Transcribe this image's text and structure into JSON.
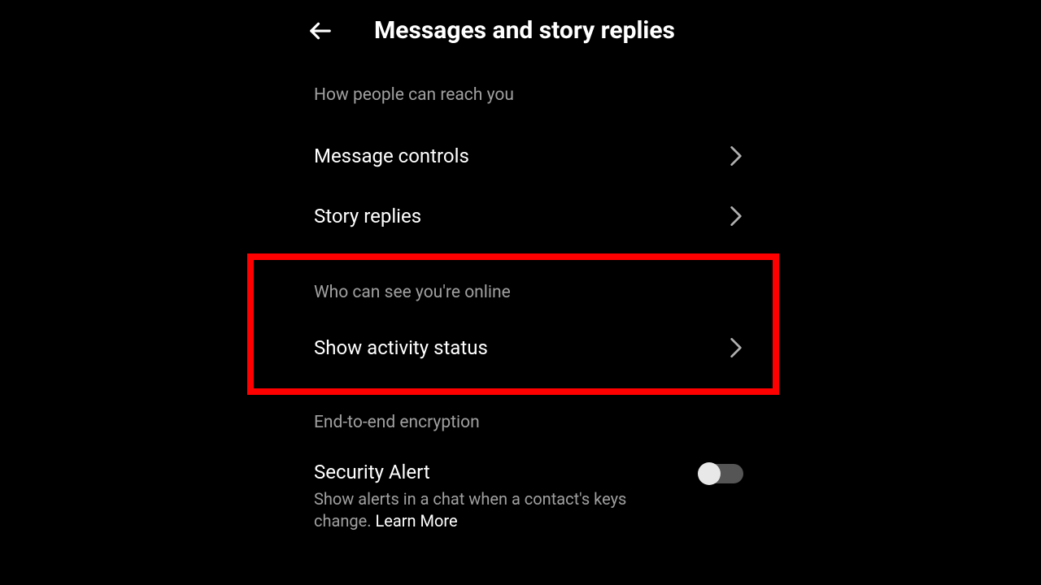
{
  "header": {
    "title": "Messages and story replies"
  },
  "sections": {
    "reach": {
      "header": "How people can reach you",
      "items": {
        "message_controls": "Message controls",
        "story_replies": "Story replies"
      }
    },
    "online": {
      "header": "Who can see you're online",
      "items": {
        "activity_status": "Show activity status"
      }
    },
    "encryption": {
      "header": "End-to-end encryption",
      "security_alert": {
        "title": "Security Alert",
        "subtitle_prefix": "Show alerts in a chat when a contact's keys change. ",
        "learn_more": "Learn More",
        "toggle_on": false
      }
    }
  }
}
